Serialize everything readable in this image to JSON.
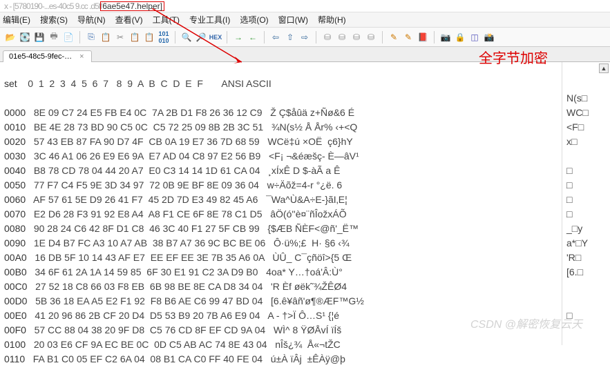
{
  "title": {
    "blur_prefix": "x - [5780190-...es-40c5 9.cc .d5ff",
    "helper": "6ae5e47.helper]"
  },
  "menu": {
    "edit": "编辑(E)",
    "search": "搜索(S)",
    "nav": "导航(N)",
    "view": "查看(V)",
    "tools": "工具(T)",
    "spec": "专业工具(I)",
    "options": "选项(O)",
    "window": "窗口(W)",
    "help": "帮助(H)"
  },
  "tab": {
    "label": "01e5-48c5-9fec-…",
    "close": "×"
  },
  "overlay": {
    "red_text": "全字节加密"
  },
  "hex": {
    "header_offset": "set",
    "header_cols": " 0  1  2  3  4  5  6  7   8  9  A  B  C  D  E  F",
    "header_ansi": "       ANSI ASCII",
    "rows": [
      {
        "off": "0000",
        "b": "8E 09 C7 24 E5 FB E4 0C  7A 2B D1 F8 26 36 12 C9",
        "a": "Ž Ç$åûä z+Ñø&6 É"
      },
      {
        "off": "0010",
        "b": "BE 4E 28 73 BD 90 C5 0C  C5 72 25 09 8B 2B 3C 51",
        "a": "¾N(s½ Å År% ‹+<Q"
      },
      {
        "off": "0020",
        "b": "57 43 EB 87 FA 90 D7 4F  CB 0A 19 E7 36 7D 68 59",
        "a": "WCë‡ú ×OË  ç6}hY"
      },
      {
        "off": "0030",
        "b": "3C 46 A1 06 26 E9 E6 9A  E7 AD 04 C8 97 E2 56 B9",
        "a": "<F¡ ¬&éæšç- È—âV¹"
      },
      {
        "off": "0040",
        "b": "B8 78 CD 78 04 44 20 A7  E0 C3 14 14 1D 61 CA 04",
        "a": "¸xÍxÊ D $-àÃ a Ê"
      },
      {
        "off": "0050",
        "b": "77 F7 C4 F5 9E 3D 34 97  72 0B 9E BF 8E 09 36 04",
        "a": "w÷Äõž=4-r °¿ë. 6"
      },
      {
        "off": "0060",
        "b": "AF 57 61 5E D9 26 41 F7  45 2D 7D E3 49 82 45 A6",
        "a": "¯Wa^Ù&A÷E-}ãI‚E¦"
      },
      {
        "off": "0070",
        "b": "E2 D6 28 F3 91 92 E8 A4  A8 F1 CE 6F 8E 78 C1 D5",
        "a": "âÖ(ó''è¤¨ñÎožxÁÕ"
      },
      {
        "off": "0080",
        "b": "90 28 24 C6 42 8F D1 C8  46 3C 40 F1 27 5F CB 99",
        "a": "{$ÆB ÑÈF<@ñ'_Ë™"
      },
      {
        "off": "0090",
        "b": "1E D4 B7 FC A3 10 A7 AB  38 B7 A7 36 9C BC BE 06",
        "a": "Ô·ü%;£  H· §6 ‹¾"
      },
      {
        "off": "00A0",
        "b": "16 DB 5F 10 14 43 AF E7  EE EF EE 3E 7B 35 A6 0A",
        "a": "ÙÛ_ C¯çñöî>{5 Œ"
      },
      {
        "off": "00B0",
        "b": "34 6F 61 2A 1A 14 59 85  6F 30 E1 91 C2 3A D9 B0",
        "a": "4oa* Y…†oá'Â:Ù°"
      },
      {
        "off": "00C0",
        "b": "27 52 18 C8 66 03 F8 EB  6B 98 BE 8E CA D8 34 04",
        "a": "'R Èf øëk˜¾ŽÊØ4"
      },
      {
        "off": "00D0",
        "b": "5B 36 18 EA A5 E2 F1 92  F8 B6 AE C6 99 47 BD 04",
        "a": "[6.ê¥âñ'ø¶®ÆF™G½"
      },
      {
        "off": "00E0",
        "b": "41 20 96 86 2B CF 20 D4  D5 53 B9 20 7B A6 E9 04",
        "a": "A - †>Ï Ô…S¹ {¦é"
      },
      {
        "off": "00F0",
        "b": "57 CC 88 04 38 20 9F D8  C5 76 CD 8F EF CD 9A 04",
        "a": "WÌ^ 8 ŸØÅvÍ ïÍš"
      },
      {
        "off": "0100",
        "b": "20 03 E6 CF 9A EC BE 0C  0D C5 AB AC 74 8E 43 04",
        "a": "nÎš¿¾  Å«¬tŽC"
      },
      {
        "off": "0110",
        "b": "FA B1 C0 05 EF C2 6A 04  08 B1 CA C0 FF 40 FE 04",
        "a": "ú±À ïÂj  ±ÊÀÿ@þ"
      }
    ]
  },
  "side": {
    "lines": [
      "",
      "",
      "N(s□",
      "WC□",
      "<F□",
      "x□",
      "",
      "□",
      "□",
      "□",
      "□",
      "_□y",
      "a*□Y",
      "'R□",
      "[6.□",
      "",
      "",
      "□",
      ""
    ]
  },
  "watermark": "CSDN @解密恢复云天"
}
